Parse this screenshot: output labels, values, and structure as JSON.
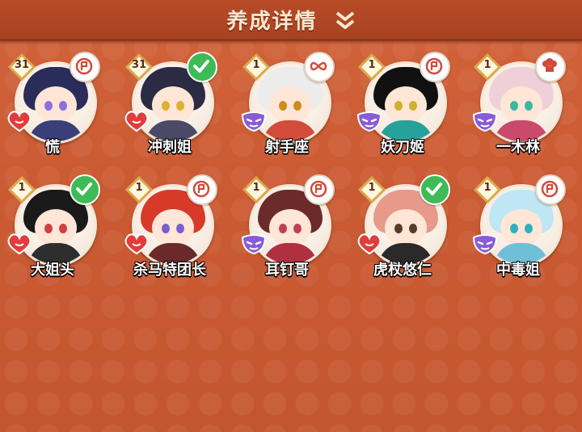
{
  "header": {
    "title": "养成详情"
  },
  "colors": {
    "heart_red": "#e23c3c",
    "mask_purple": "#8a5bd6",
    "check_green": "#3dbb55"
  },
  "characters": [
    {
      "name": "慌",
      "level": "31",
      "badge": "scroll-icon",
      "emblem": "heart-red",
      "hair": "#2a2c5a",
      "body": "#3a3f7a",
      "eye": "#8d6fe0"
    },
    {
      "name": "冲刺姐",
      "level": "31",
      "badge": "check-icon",
      "emblem": "heart-red",
      "hair": "#2b2b44",
      "body": "#4a4a66",
      "eye": "#e0b030"
    },
    {
      "name": "射手座",
      "level": "1",
      "badge": "infinity-icon",
      "emblem": "mask-purple",
      "hair": "#ececec",
      "body": "#d34b3b",
      "eye": "#d08a20"
    },
    {
      "name": "妖刀姬",
      "level": "1",
      "badge": "scroll-icon",
      "emblem": "mask-purple",
      "hair": "#111111",
      "body": "#26a29a",
      "eye": "#d0b030"
    },
    {
      "name": "一木林",
      "level": "1",
      "badge": "chef-hat-icon",
      "emblem": "mask-purple",
      "hair": "#f0d0d8",
      "body": "#c94a6a",
      "eye": "#3fb6a0"
    },
    {
      "name": "大姐头",
      "level": "1",
      "badge": "check-icon",
      "emblem": "heart-red",
      "hair": "#1a1a1a",
      "body": "#2e2e2e",
      "eye": "#d04040"
    },
    {
      "name": "杀马特团长",
      "level": "1",
      "badge": "scroll-icon",
      "emblem": "heart-red",
      "hair": "#d83a2a",
      "body": "#6a2a2a",
      "eye": "#7a5fd0"
    },
    {
      "name": "耳钉哥",
      "level": "1",
      "badge": "scroll-icon",
      "emblem": "mask-purple",
      "hair": "#6b2b2b",
      "body": "#b03040",
      "eye": "#c04050"
    },
    {
      "name": "虎杖悠仁",
      "level": "1",
      "badge": "check-icon",
      "emblem": "heart-red",
      "hair": "#e79a8a",
      "body": "#2a2a2a",
      "eye": "#5a3a2a"
    },
    {
      "name": "中毒姐",
      "level": "1",
      "badge": "scroll-icon",
      "emblem": "mask-purple",
      "hair": "#bfe6f4",
      "body": "#6fbfd8",
      "eye": "#2fb0c0"
    }
  ]
}
